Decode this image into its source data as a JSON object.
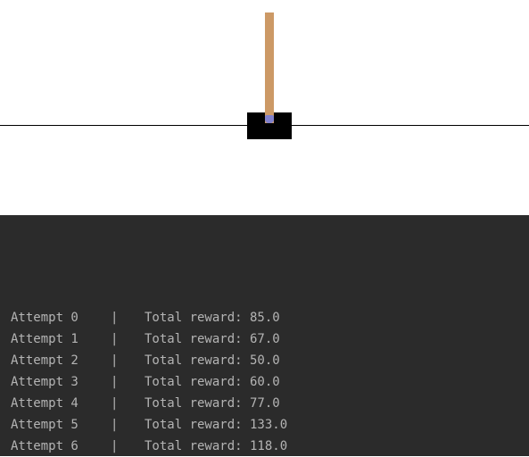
{
  "environment": {
    "colors": {
      "background": "#ffffff",
      "track": "#000000",
      "cart": "#000000",
      "pole": "#cc9966",
      "axle": "#8080cc"
    },
    "pole_tilt": "upright"
  },
  "console": {
    "background": "#2b2b2b",
    "text_color": "#b4b4b4",
    "lines": [
      {
        "attempt": "Attempt 0",
        "sep": "|",
        "reward": "Total reward: 85.0"
      },
      {
        "attempt": "Attempt 1",
        "sep": "|",
        "reward": "Total reward: 67.0"
      },
      {
        "attempt": "Attempt 2",
        "sep": "|",
        "reward": "Total reward: 50.0"
      },
      {
        "attempt": "Attempt 3",
        "sep": "|",
        "reward": "Total reward: 60.0"
      },
      {
        "attempt": "Attempt 4",
        "sep": "|",
        "reward": "Total reward: 77.0"
      },
      {
        "attempt": "Attempt 5",
        "sep": "|",
        "reward": "Total reward: 133.0"
      },
      {
        "attempt": "Attempt 6",
        "sep": "|",
        "reward": "Total reward: 118.0"
      }
    ]
  }
}
